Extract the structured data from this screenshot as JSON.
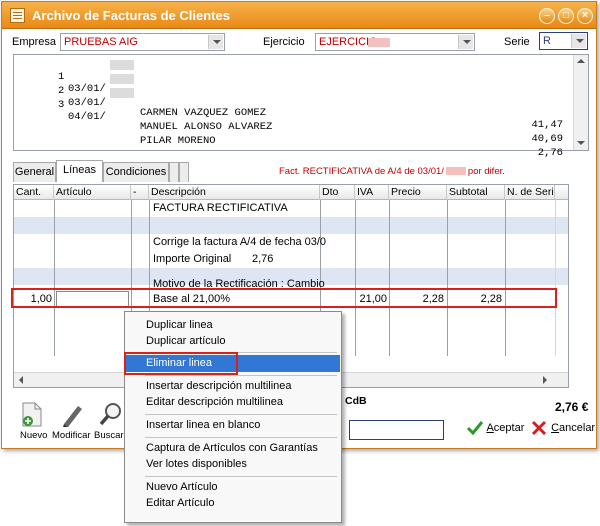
{
  "window": {
    "title": "Archivo de Facturas de Clientes",
    "controls": [
      "minimize",
      "restore",
      "close"
    ]
  },
  "header": {
    "empresa_label": "Empresa",
    "empresa_value": "PRUEBAS AIG",
    "ejercicio_label": "Ejercicio",
    "ejercicio_value": "EJERCICIO",
    "serie_label": "Serie",
    "serie_value": "R"
  },
  "invoice_list": [
    {
      "num": "1",
      "date": "03/01/",
      "name": "CARMEN VAZQUEZ GOMEZ",
      "amount": "41,47"
    },
    {
      "num": "2",
      "date": "03/01/",
      "name": "MANUEL ALONSO ALVAREZ",
      "amount": "40,69"
    },
    {
      "num": "3",
      "date": "04/01/",
      "name": "PILAR MORENO",
      "amount": "2,76"
    }
  ],
  "tabs": [
    {
      "label": "General",
      "active": false
    },
    {
      "label": "Líneas",
      "active": true
    },
    {
      "label": "Condiciones",
      "active": false
    }
  ],
  "fact_note": {
    "prefix": "Fact. RECTIFICATIVA de A/4 de 03/01/",
    "suffix": "por difer."
  },
  "grid": {
    "columns": [
      "Cant.",
      "Artículo",
      "-",
      "Descripción",
      "Dto",
      "IVA",
      "Precio",
      "Subtotal",
      "N. de Serie"
    ],
    "desc_lines": [
      "FACTURA RECTIFICATIVA",
      "",
      "Corrige la factura A/4 de fecha 03/0",
      "Importe Original",
      "",
      "Motivo de la Rectificación : Cambio",
      "Base al  21,00%"
    ],
    "importe_original_value": "2,76",
    "selected": {
      "cant": "1,00",
      "iva": "21,00",
      "precio": "2,28",
      "subtotal": "2,28"
    }
  },
  "toolbar": {
    "nuevo": "Nuevo",
    "modificar": "Modificar",
    "buscar": "Buscar"
  },
  "footer": {
    "cdb_label": "CdB",
    "total": "2,76 €",
    "aceptar_prefix": "A",
    "aceptar_rest": "ceptar",
    "cancelar_prefix": "C",
    "cancelar_rest": "ancelar"
  },
  "context_menu": {
    "items": [
      "Duplicar linea",
      "Duplicar artículo",
      "Eliminar linea",
      "Insertar descripción multilinea",
      "Editar descripción multilinea",
      "Insertar linea en blanco",
      "Captura de Artículos con Garantías",
      "Ver lotes disponibles",
      "Nuevo Artículo",
      "Editar Artículo"
    ],
    "highlighted_index": 2
  },
  "colors": {
    "title_bar": "#e88a16",
    "accent_red": "#d8201d",
    "row_alt": "#dfe6f3",
    "menu_highlight": "#3277d3"
  }
}
